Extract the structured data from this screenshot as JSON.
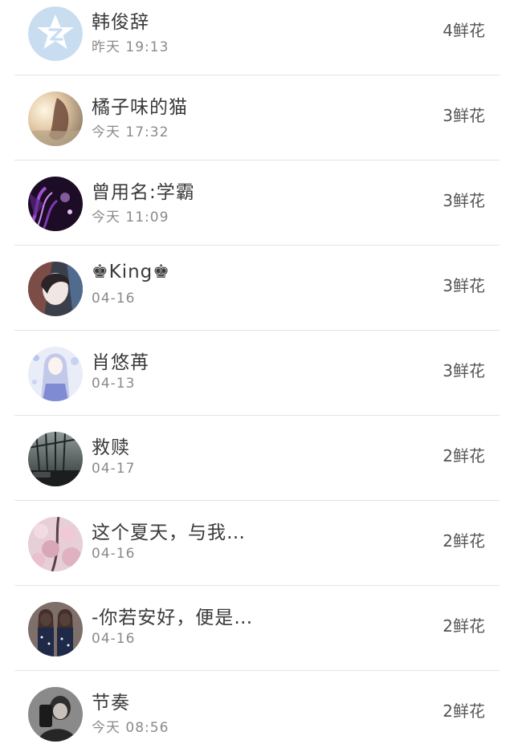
{
  "items": [
    {
      "name": "韩俊辞",
      "time": "昨天 19:13",
      "flowers": "4鲜花",
      "avatar": "qq-default-avatar"
    },
    {
      "name": "橘子味的猫",
      "time": "今天 17:32",
      "flowers": "3鲜花",
      "avatar": "sunset-hand-photo"
    },
    {
      "name": "曾用名:学霸",
      "time": "今天 11:09",
      "flowers": "3鲜花",
      "avatar": "purple-dark-art"
    },
    {
      "name": "♚King♚",
      "time": "04-16",
      "flowers": "3鲜花",
      "avatar": "girl-portrait"
    },
    {
      "name": "肖悠苒",
      "time": "04-13",
      "flowers": "3鲜花",
      "avatar": "anime-girl-blue"
    },
    {
      "name": "救赎",
      "time": "04-17",
      "flowers": "2鲜花",
      "avatar": "bridge-city-photo"
    },
    {
      "name": "这个夏天，与我…",
      "time": "04-16",
      "flowers": "2鲜花",
      "avatar": "cherry-blossom-photo"
    },
    {
      "name": "-你若安好，便是…",
      "time": "04-16",
      "flowers": "2鲜花",
      "avatar": "two-girls-photo"
    },
    {
      "name": "节奏",
      "time": "今天 08:56",
      "flowers": "2鲜花",
      "avatar": "selfie-boy-photo"
    }
  ]
}
